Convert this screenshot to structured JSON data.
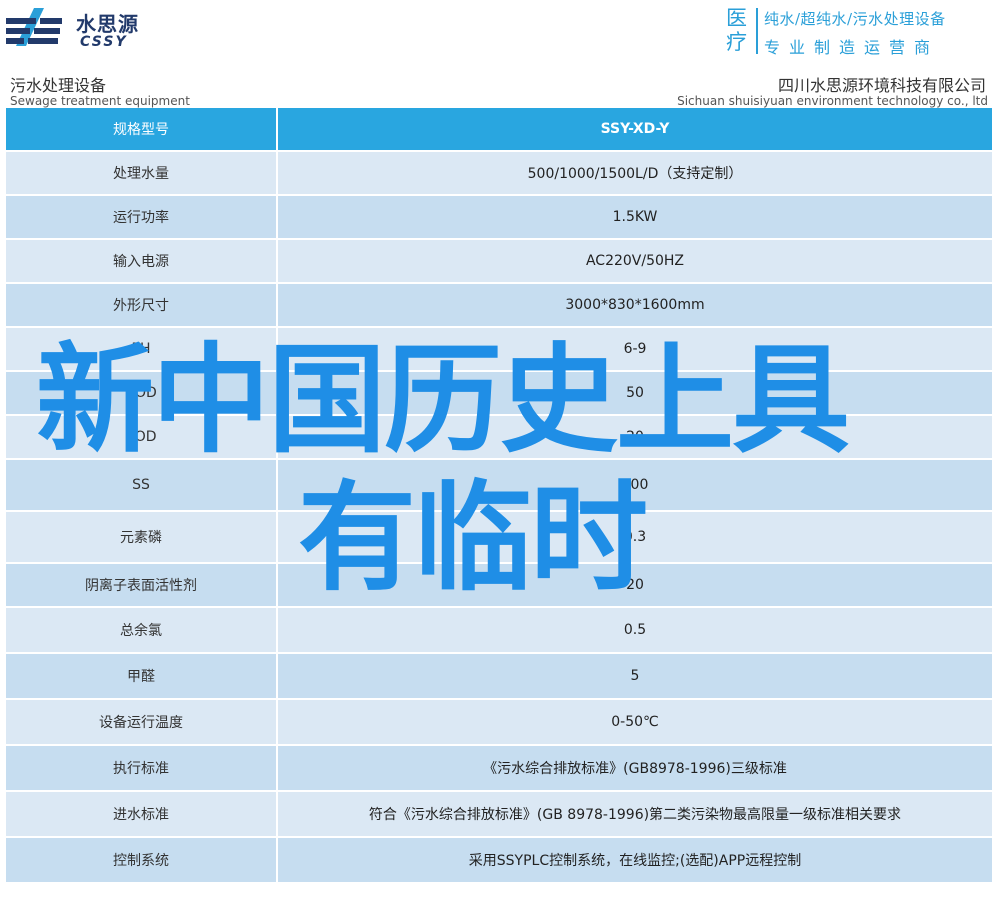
{
  "header": {
    "logo_cn": "水思源",
    "logo_en": "CSSY",
    "slogan_big": "医疗",
    "slogan_top": "纯水/超纯水/污水处理设备",
    "slogan_bottom": "专业制造运营商"
  },
  "section": {
    "left_cn": "污水处理设备",
    "left_en": "Sewage treatment equipment",
    "right_cn": "四川水思源环境科技有限公司",
    "right_en": "Sichuan shuisiyuan environment technology co., ltd"
  },
  "table": {
    "head": {
      "label": "规格型号",
      "value": "SSY-XD-Y"
    },
    "rows": [
      {
        "label": "处理水量",
        "value": "500/1000/1500L/D（支持定制）"
      },
      {
        "label": "运行功率",
        "value": "1.5KW"
      },
      {
        "label": "输入电源",
        "value": "AC220V/50HZ"
      },
      {
        "label": "外形尺寸",
        "value": "3000*830*1600mm"
      },
      {
        "label": "PH",
        "value": "6-9"
      },
      {
        "label": "COD",
        "value": "50"
      },
      {
        "label": "BOD",
        "value": "20"
      },
      {
        "label": "SS",
        "value": "400"
      },
      {
        "label": "元素磷",
        "value": "0.3"
      },
      {
        "label": "阴离子表面活性剂",
        "value": "20"
      },
      {
        "label": "总余氯",
        "value": "0.5"
      },
      {
        "label": "甲醛",
        "value": "5"
      },
      {
        "label": "设备运行温度",
        "value": "0-50℃"
      },
      {
        "label": "执行标准",
        "value": "《污水综合排放标准》(GB8978-1996)三级标准"
      },
      {
        "label": "进水标准",
        "value": "符合《污水综合排放标准》(GB 8978-1996)第二类污染物最高限量一级标准相关要求"
      },
      {
        "label": "控制系统",
        "value": "采用SSYPLC控制系统，在线监控;(选配)APP远程控制"
      }
    ]
  },
  "overlay": {
    "line1": "新中国历史上具",
    "line2": "有临时"
  },
  "colors": {
    "header_blue": "#29a6e0",
    "row_light": "#dbe8f4",
    "row_dark": "#c6ddf0",
    "overlay_text": "#1f8ee6"
  }
}
